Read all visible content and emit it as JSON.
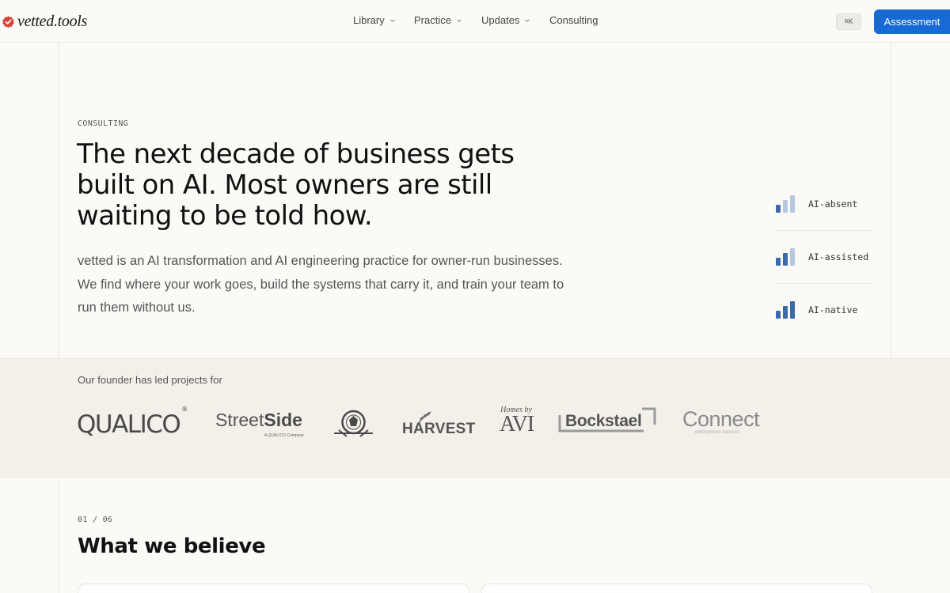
{
  "header": {
    "logo_text": "vetted.tools",
    "nav": [
      {
        "label": "Library",
        "has_dropdown": true
      },
      {
        "label": "Practice",
        "has_dropdown": true
      },
      {
        "label": "Updates",
        "has_dropdown": true
      },
      {
        "label": "Consulting",
        "has_dropdown": false
      }
    ],
    "shortcut": "⌘K",
    "cta_label": "Assessment"
  },
  "hero": {
    "eyebrow": "CONSULTING",
    "headline": "The next decade of business gets built on AI. Most owners are still waiting to be told how.",
    "lede": "vetted is an AI transformation and AI engineering practice for owner-run businesses. We find where your work goes, build the systems that carry it, and train your team to run them without us."
  },
  "levels": [
    {
      "label": "AI-absent",
      "filled_bars": 1
    },
    {
      "label": "AI-assisted",
      "filled_bars": 2
    },
    {
      "label": "AI-native",
      "filled_bars": 3
    }
  ],
  "clients": {
    "title": "Our founder has led projects for",
    "qualico": "QUALICO",
    "qualico_mark": "®",
    "streetside_light": "Street",
    "streetside_bold": "Side",
    "streetside_sub": "A QUALICO Company",
    "harvest": "HARVEST",
    "avi_top": "Homes by",
    "avi_bottom": "AVI",
    "bockstael": "Bockstael",
    "connect": "Connect",
    "connect_sub": "employment services"
  },
  "section": {
    "number": "01 / 06",
    "title": "What we believe"
  },
  "colors": {
    "accent": "#1769d6",
    "bar_filled": "#3a6aa8",
    "bar_empty": "#b5c8df",
    "logo_mark": "#d9433a",
    "background": "#fbfaf7",
    "band": "#f3f0e9"
  }
}
